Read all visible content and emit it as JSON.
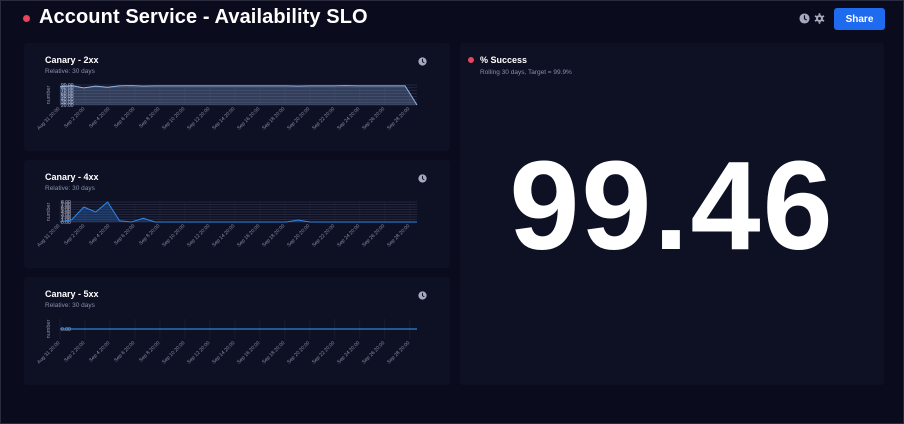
{
  "header": {
    "title": "Account Service - Availability SLO",
    "share_label": "Share",
    "icons": [
      "clock-icon",
      "gear-icon"
    ],
    "accent_color": "#1f6bf0",
    "status_color": "#e8455c"
  },
  "panels": [
    {
      "title": "Canary - 2xx",
      "subtitle": "Relative: 30 days",
      "ylabel": "number",
      "y_ticks": [
        "90.00",
        "80.00",
        "70.00",
        "60.00",
        "50.00",
        "40.00",
        "30.00",
        "20.00"
      ],
      "x_ticks": [
        "Aug 31 20:00",
        "Sep 2 20:00",
        "Sep 4 20:00",
        "Sep 6 20:00",
        "Sep 8 20:00",
        "Sep 10 20:00",
        "Sep 12 20:00",
        "Sep 14 20:00",
        "Sep 16 20:00",
        "Sep 18 20:00",
        "Sep 20 20:00",
        "Sep 22 20:00",
        "Sep 24 20:00",
        "Sep 26 20:00",
        "Sep 28 20:00"
      ]
    },
    {
      "title": "Canary - 4xx",
      "subtitle": "Relative: 30 days",
      "ylabel": "number",
      "y_ticks": [
        "8.00",
        "7.00",
        "6.00",
        "5.00",
        "4.00",
        "3.00",
        "2.00",
        "1.00",
        "0.00"
      ],
      "x_ticks": [
        "Aug 31 20:00",
        "Sep 2 20:00",
        "Sep 4 20:00",
        "Sep 6 20:00",
        "Sep 8 20:00",
        "Sep 10 20:00",
        "Sep 12 20:00",
        "Sep 14 20:00",
        "Sep 16 20:00",
        "Sep 18 20:00",
        "Sep 20 20:00",
        "Sep 22 20:00",
        "Sep 24 20:00",
        "Sep 26 20:00",
        "Sep 28 20:00"
      ]
    },
    {
      "title": "Canary - 5xx",
      "subtitle": "Relative: 30 days",
      "ylabel": "number",
      "y_ticks": [
        "0.00"
      ],
      "x_ticks": [
        "Aug 31 20:00",
        "Sep 2 20:00",
        "Sep 4 20:00",
        "Sep 6 20:00",
        "Sep 8 20:00",
        "Sep 10 20:00",
        "Sep 12 20:00",
        "Sep 14 20:00",
        "Sep 16 20:00",
        "Sep 18 20:00",
        "Sep 20 20:00",
        "Sep 22 20:00",
        "Sep 24 20:00",
        "Sep 26 20:00",
        "Sep 28 20:00"
      ]
    }
  ],
  "success_panel": {
    "title": "% Success",
    "subtitle": "Rolling 30 days, Target = 99.9%",
    "value": "99.46"
  },
  "chart_data": [
    {
      "type": "area",
      "title": "Canary - 2xx",
      "ylabel": "number",
      "ylim": [
        20,
        90
      ],
      "x": [
        0,
        1,
        2,
        3,
        4,
        5,
        6,
        7,
        8,
        9,
        10,
        11,
        12,
        13,
        14,
        15,
        16,
        17,
        18,
        19,
        20,
        21,
        22,
        23,
        24,
        25,
        26,
        27,
        28,
        29,
        30
      ],
      "series": [
        {
          "values": [
            84,
            88,
            80,
            86,
            82,
            87,
            88,
            86,
            87,
            87,
            87,
            87,
            87,
            87,
            87,
            87,
            87,
            87,
            87,
            87,
            86,
            87,
            87,
            87,
            88,
            87,
            87,
            87,
            87,
            87,
            20
          ]
        }
      ],
      "color": "#8fb4e6"
    },
    {
      "type": "area",
      "title": "Canary - 4xx",
      "ylabel": "number",
      "ylim": [
        0,
        8
      ],
      "x": [
        0,
        1,
        2,
        3,
        4,
        5,
        6,
        7,
        8,
        9,
        10,
        11,
        12,
        13,
        14,
        15,
        16,
        17,
        18,
        19,
        20,
        21,
        22,
        23,
        24,
        25,
        26,
        27,
        28,
        29,
        30
      ],
      "series": [
        {
          "values": [
            0,
            1,
            6,
            4,
            8,
            0.5,
            0,
            1.5,
            0,
            0,
            0,
            0,
            0,
            0,
            0,
            0,
            0,
            0,
            0,
            0,
            0.8,
            0,
            0,
            0,
            0,
            0,
            0,
            0,
            0,
            0,
            0
          ]
        }
      ],
      "color": "#2f86e8"
    },
    {
      "type": "line",
      "title": "Canary - 5xx",
      "ylabel": "number",
      "ylim": [
        0,
        0
      ],
      "x": [
        0,
        30
      ],
      "series": [
        {
          "values": [
            0,
            0
          ]
        }
      ],
      "color": "#3aa0ff"
    }
  ]
}
